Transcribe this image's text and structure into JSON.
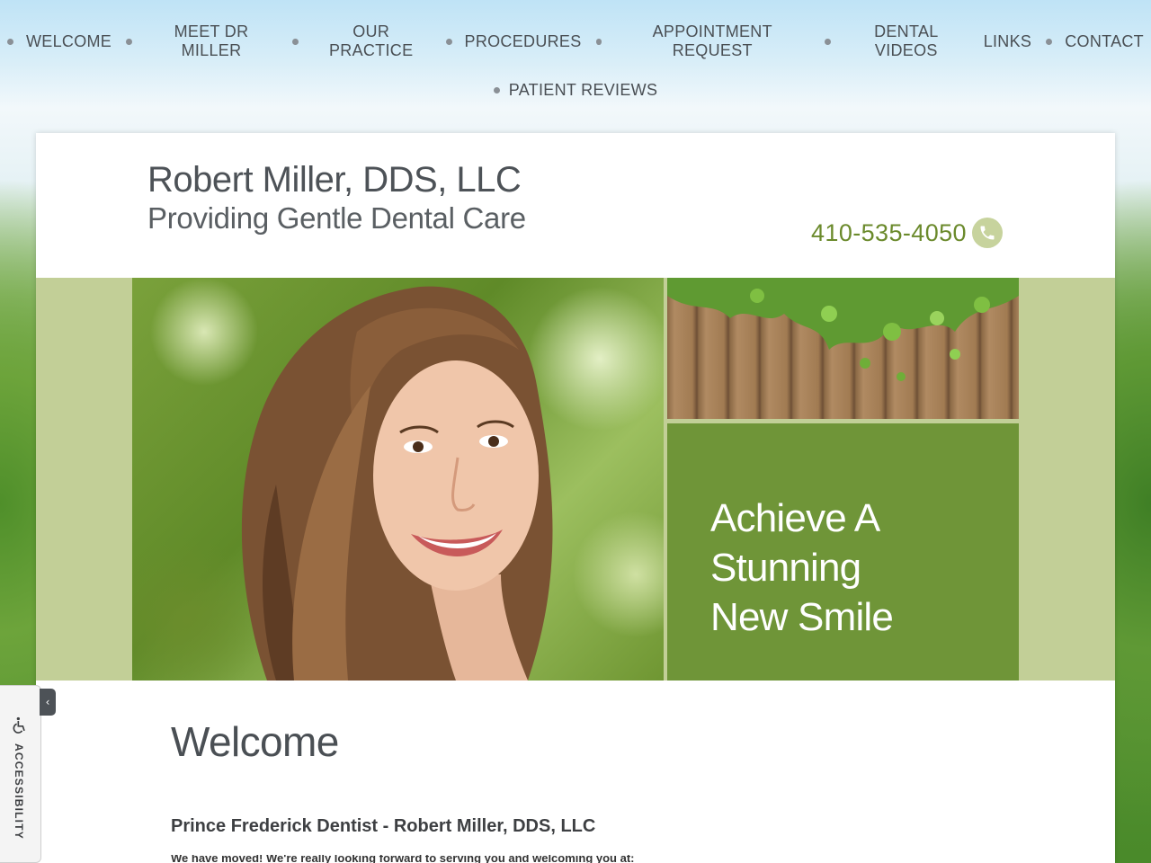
{
  "nav": {
    "items": [
      {
        "label": "WELCOME"
      },
      {
        "label": "MEET DR MILLER"
      },
      {
        "label": "OUR PRACTICE"
      },
      {
        "label": "PROCEDURES"
      },
      {
        "label": "APPOINTMENT REQUEST"
      },
      {
        "label": "DENTAL VIDEOS"
      },
      {
        "label": "LINKS"
      },
      {
        "label": "CONTACT"
      },
      {
        "label": "PATIENT REVIEWS"
      }
    ]
  },
  "header": {
    "name": "Robert Miller, DDS, LLC",
    "tagline": "Providing Gentle Dental Care",
    "phone": "410-535-4050",
    "phone_icon": "phone-icon"
  },
  "hero": {
    "photo_icon": "smiling-woman-photo",
    "fence_icon": "wooden-fence-with-ivy-image",
    "tagline_lines": [
      "Achieve A",
      "Stunning",
      "New Smile"
    ]
  },
  "content": {
    "heading": "Welcome",
    "subheading": "Prince Frederick Dentist - Robert Miller, DDS, LLC",
    "intro": "We have moved! We're really looking forward to serving you and welcoming you at:"
  },
  "accessibility": {
    "label": "ACCESSIBILITY",
    "toggle": "‹",
    "icon": "wheelchair-icon"
  },
  "colors": {
    "accent_green": "#6f9538",
    "light_green": "#c2cf97",
    "phone_green": "#6b8a2c",
    "text_gray": "#4a4f54"
  }
}
